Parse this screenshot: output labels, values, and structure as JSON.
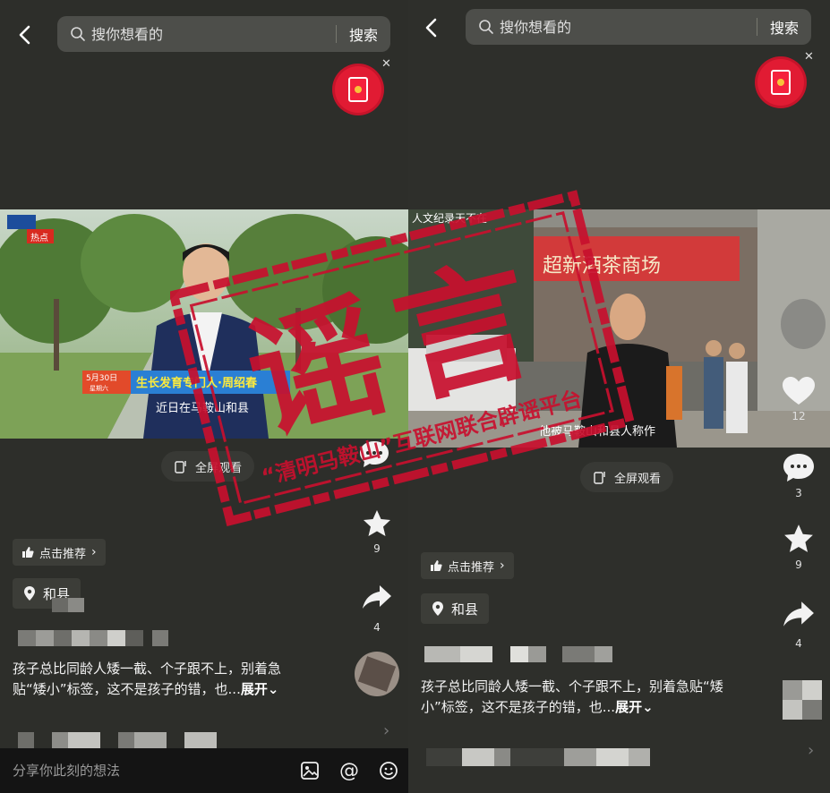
{
  "left": {
    "search": {
      "placeholder": "搜你想看的",
      "button": "搜索"
    },
    "video": {
      "news_date": "5月30日",
      "news_weekday": "星期六",
      "badge_text": "热点",
      "headline": "生长发育专门人·周绍春",
      "subtitle": "近日在马鞍山和县"
    },
    "full_screen": "全屏观看",
    "recommend": "点击推荐",
    "location": "和县",
    "description": "孩子总比同龄人矮一截、个子跟不上，别着急贴“矮小”标签，这不是孩子的错，也...",
    "expand": "展开",
    "counts": {
      "favorite": "9",
      "share": "4"
    },
    "comment_placeholder": "分享你此刻的想法"
  },
  "right": {
    "search": {
      "placeholder": "搜你想看的",
      "button": "搜索"
    },
    "video": {
      "top_caption": "人文纪录天不在",
      "shop_sign": "超新酒茶商场",
      "subtitle": "他被马鞍山和县人称作"
    },
    "full_screen": "全屏观看",
    "recommend": "点击推荐",
    "location": "和县",
    "description": "孩子总比同龄人矮一截、个子跟不上，别着急贴“矮小”标签，这不是孩子的错，也...",
    "expand": "展开",
    "counts": {
      "like": "12",
      "comment": "3",
      "favorite": "9",
      "share": "4"
    }
  },
  "stamp": {
    "main": "谣言",
    "arc_text": "“清明马鞍山”互联网联合辟谣平台"
  },
  "colors": {
    "stamp_red": "#c8102e",
    "background": "#2d2e2a"
  }
}
